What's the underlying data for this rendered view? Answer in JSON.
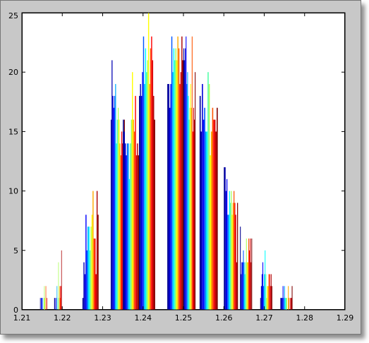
{
  "chart_data": {
    "type": "bar",
    "title": "",
    "xlabel": "",
    "ylabel": "",
    "xlim": [
      1.21,
      1.29
    ],
    "ylim": [
      0,
      25
    ],
    "xticks": [
      "1.21",
      "1.22",
      "1.23",
      "1.24",
      "1.25",
      "1.26",
      "1.27",
      "1.28",
      "1.29"
    ],
    "yticks": [
      "0",
      "5",
      "10",
      "15",
      "20",
      "25"
    ],
    "grid": false,
    "legend": "none",
    "colormap": "jet",
    "colormap_stops": [
      "#00008f",
      "#0000ff",
      "#00ffff",
      "#ffff00",
      "#ff0000",
      "#800000"
    ],
    "clusters": [
      {
        "x": [
          1.2145,
          1.2165
        ],
        "heights": [
          1,
          0,
          1,
          1,
          1,
          0,
          0,
          1,
          2,
          1,
          0,
          2,
          0,
          1,
          0,
          0
        ]
      },
      {
        "x": [
          1.218,
          1.22
        ],
        "heights": [
          1,
          1,
          0,
          1,
          0,
          2,
          0,
          1,
          4,
          0,
          2,
          1,
          2,
          2,
          5,
          0
        ]
      },
      {
        "x": [
          1.225,
          1.229
        ],
        "heights": [
          1,
          4,
          3,
          8,
          5,
          7,
          7,
          5,
          7,
          8,
          10,
          6,
          6,
          3,
          10,
          8
        ]
      },
      {
        "x": [
          1.232,
          1.2355
        ],
        "heights": [
          16,
          21,
          18,
          17,
          18,
          19,
          14,
          16,
          17,
          16,
          14,
          13,
          15,
          14,
          13,
          16
        ]
      },
      {
        "x": [
          1.235,
          1.239
        ],
        "heights": [
          16,
          15,
          14,
          13,
          14,
          14,
          11,
          14,
          16,
          20,
          16,
          15,
          18,
          13,
          14,
          13
        ]
      },
      {
        "x": [
          1.239,
          1.243
        ],
        "heights": [
          18,
          19,
          18,
          20,
          23,
          19,
          22,
          20,
          21,
          25,
          19,
          22,
          23,
          21,
          18,
          16
        ]
      },
      {
        "x": [
          1.246,
          1.25
        ],
        "heights": [
          19,
          19,
          17,
          19,
          23,
          20,
          22,
          21,
          22,
          21,
          23,
          22,
          19,
          20,
          23,
          21
        ]
      },
      {
        "x": [
          1.25,
          1.253
        ],
        "heights": [
          22,
          21,
          22,
          23,
          19,
          20,
          18,
          16,
          17,
          19,
          17,
          23,
          15,
          17,
          16,
          20
        ]
      },
      {
        "x": [
          1.254,
          1.2585
        ],
        "heights": [
          18,
          15,
          19,
          16,
          17,
          15,
          15,
          20,
          19,
          13,
          15,
          17,
          16,
          16,
          15,
          17
        ]
      },
      {
        "x": [
          1.26,
          1.2635
        ],
        "heights": [
          12,
          12,
          10,
          11,
          8,
          8,
          10,
          9,
          10,
          8,
          9,
          10,
          9,
          8,
          4,
          9
        ]
      },
      {
        "x": [
          1.264,
          1.267
        ],
        "heights": [
          7,
          3,
          4,
          4,
          5,
          4,
          3,
          4,
          6,
          4,
          4,
          6,
          5,
          6,
          4,
          6
        ]
      },
      {
        "x": [
          1.269,
          1.272
        ],
        "heights": [
          1,
          2,
          3,
          4,
          2,
          3,
          5,
          3,
          1,
          2,
          2,
          3,
          3,
          2,
          3,
          2
        ]
      },
      {
        "x": [
          1.274,
          1.277
        ],
        "heights": [
          1,
          1,
          1,
          2,
          1,
          2,
          1,
          1,
          1,
          0,
          2,
          1,
          0,
          1,
          1,
          2
        ]
      }
    ]
  }
}
